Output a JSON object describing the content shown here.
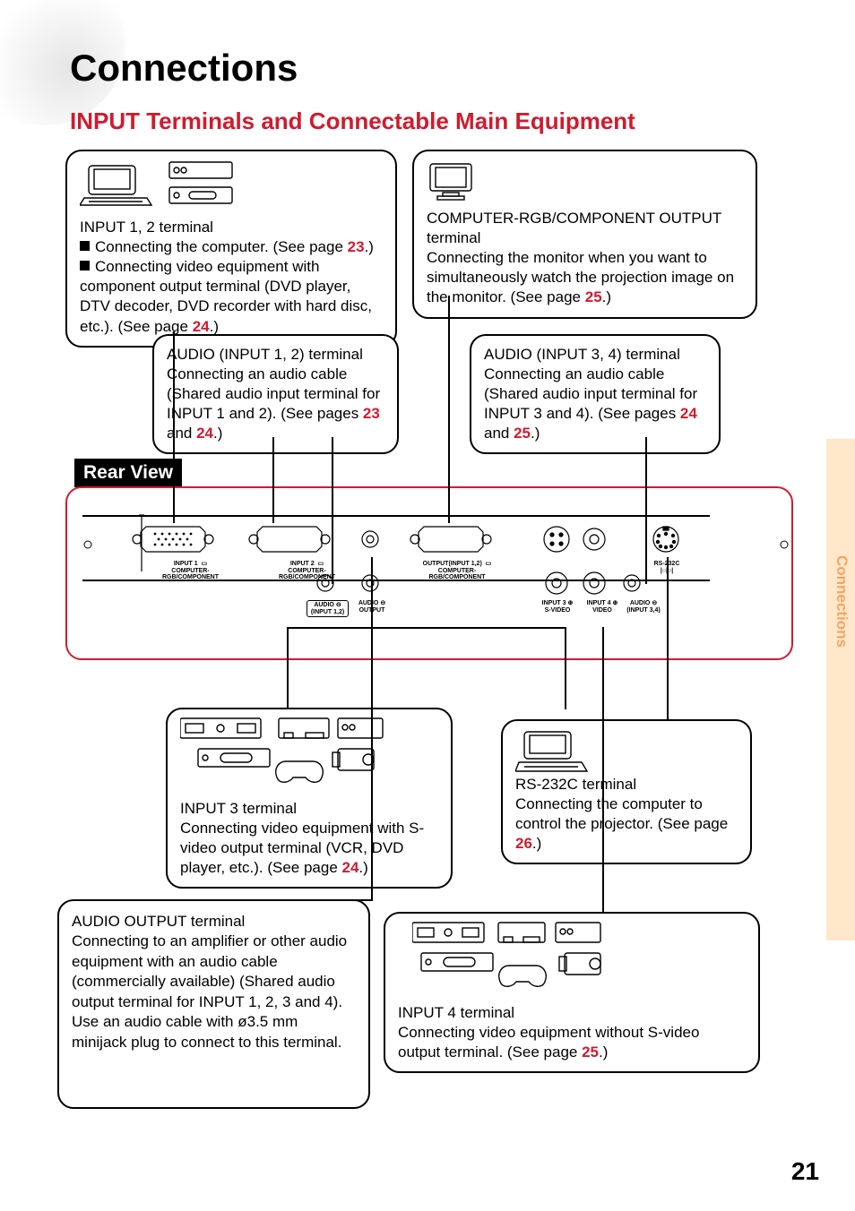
{
  "page_title": "Connections",
  "subtitle": "INPUT Terminals and Connectable Main Equipment",
  "page_number": "21",
  "side_tab": "Connections",
  "rear_label": "Rear View",
  "c1": {
    "title": "INPUT 1, 2 terminal",
    "l1a": "Connecting the computer. (See page ",
    "l1p": "23",
    "l1b": ".)",
    "l2a": "Connecting video equipment with component output terminal (DVD player, DTV decoder, DVD recorder with hard disc, etc.). (See page ",
    "l2p": "24",
    "l2b": ".)"
  },
  "c2": {
    "title": "COMPUTER-RGB/COMPONENT OUTPUT terminal",
    "body_a": "Connecting the monitor when you want to simultaneously watch the projection image on the monitor. (See page ",
    "body_p": "25",
    "body_b": ".)"
  },
  "c3": {
    "title": "AUDIO (INPUT 1, 2) terminal",
    "body_a": "Connecting an audio cable (Shared audio input terminal for INPUT 1 and 2). (See pages ",
    "p1": "23",
    "mid": " and ",
    "p2": "24",
    "body_b": ".)"
  },
  "c4": {
    "title": "AUDIO (INPUT 3, 4) terminal",
    "body_a": "Connecting an audio cable (Shared audio input terminal for INPUT 3 and 4). (See pages ",
    "p1": "24",
    "mid": " and ",
    "p2": "25",
    "body_b": ".)"
  },
  "c5": {
    "title": "RS-232C terminal",
    "body_a": "Connecting the computer to control the projector. (See page ",
    "p": "26",
    "body_b": ".)"
  },
  "c6": {
    "title": "INPUT 3 terminal",
    "body_a": "Connecting video equipment with S-video output terminal (VCR, DVD player, etc.). (See page ",
    "p": "24",
    "body_b": ".)"
  },
  "c7": {
    "title": "AUDIO OUTPUT terminal",
    "body": "Connecting to an amplifier or other audio equipment with an audio cable (commercially available) (Shared audio output terminal for INPUT 1, 2, 3 and 4).\nUse an audio cable with ø3.5 mm minijack plug to connect to this terminal."
  },
  "c8": {
    "title": "INPUT 4 terminal",
    "body_a": "Connecting video equipment without S-video output terminal. (See page ",
    "p": "25",
    "body_b": ".)"
  },
  "panel": {
    "input1": "INPUT 1",
    "rgb": "COMPUTER-RGB/COMPONENT",
    "input2": "INPUT 2",
    "output12": "OUTPUT(INPUT 1,2)",
    "audio_in12": "AUDIO",
    "audio_in12_sub": "(INPUT 1,2)",
    "audio_out": "AUDIO",
    "audio_out_sub": "OUTPUT",
    "input3": "INPUT 3",
    "svideo": "S-VIDEO",
    "input4": "INPUT 4",
    "video": "VIDEO",
    "audio_in34": "AUDIO",
    "audio_in34_sub": "(INPUT 3,4)",
    "rs232": "RS-232C"
  }
}
